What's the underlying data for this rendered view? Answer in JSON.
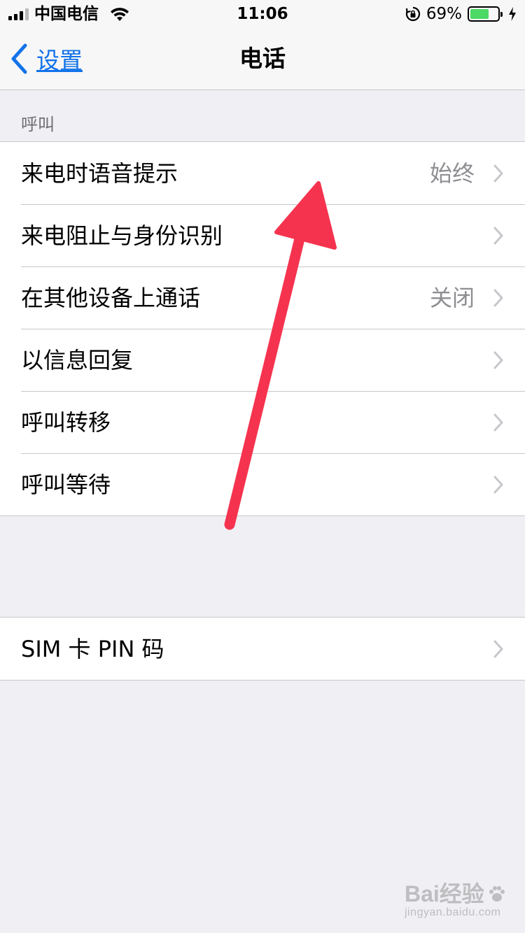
{
  "status_bar": {
    "carrier": "中国电信",
    "time": "11:06",
    "battery_percent": "69%",
    "battery_level": 0.69,
    "icons": [
      "signal-icon",
      "wifi-icon",
      "rotation-lock-icon",
      "battery-icon",
      "charging-icon"
    ]
  },
  "nav": {
    "back_label": "设置",
    "title": "电话"
  },
  "section_calls": {
    "header": "呼叫",
    "rows": [
      {
        "label": "来电时语音提示",
        "value": "始终"
      },
      {
        "label": "来电阻止与身份识别",
        "value": ""
      },
      {
        "label": "在其他设备上通话",
        "value": "关闭"
      },
      {
        "label": "以信息回复",
        "value": ""
      },
      {
        "label": "呼叫转移",
        "value": ""
      },
      {
        "label": "呼叫等待",
        "value": ""
      }
    ]
  },
  "section_sim": {
    "rows": [
      {
        "label": "SIM 卡 PIN 码",
        "value": ""
      }
    ]
  },
  "watermark": {
    "brand": "Bai经验",
    "url": "jingyan.baidu.com"
  },
  "colors": {
    "accent": "#1273ea",
    "annotation": "#f5334f",
    "battery": "#4cd964",
    "background": "#efeff4"
  }
}
